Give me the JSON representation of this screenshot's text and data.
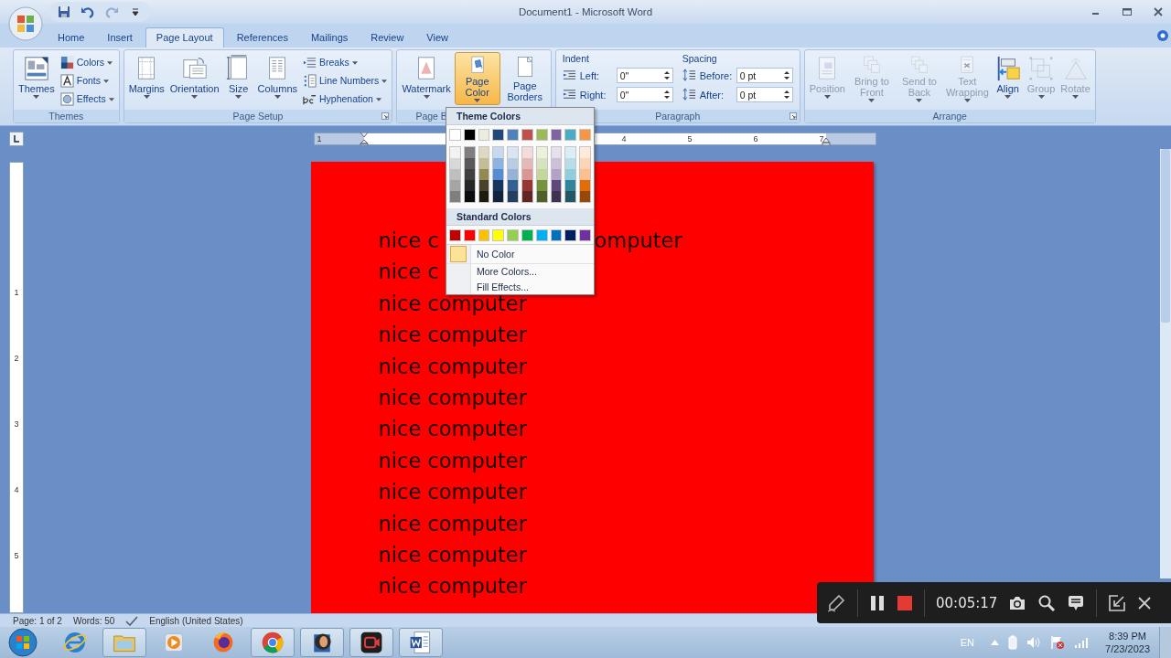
{
  "window": {
    "title": "Document1 - Microsoft Word"
  },
  "quick_access": [
    {
      "kind": "save",
      "disabled": false
    },
    {
      "kind": "undo",
      "disabled": false
    },
    {
      "kind": "redo",
      "disabled": true
    },
    {
      "kind": "customize",
      "disabled": false
    }
  ],
  "tabs": [
    {
      "label": "Home",
      "selected": false
    },
    {
      "label": "Insert",
      "selected": false
    },
    {
      "label": "Page Layout",
      "selected": true
    },
    {
      "label": "References",
      "selected": false
    },
    {
      "label": "Mailings",
      "selected": false
    },
    {
      "label": "Review",
      "selected": false
    },
    {
      "label": "View",
      "selected": false
    }
  ],
  "ribbon": {
    "groups": [
      {
        "label": "Themes",
        "launcher": false,
        "items": [
          {
            "kind": "large",
            "label": "Themes",
            "dropdown": true,
            "pressed": false,
            "disabled": false
          },
          {
            "kind": "small",
            "label": "Colors",
            "dropdown": true,
            "disabled": false
          },
          {
            "kind": "small",
            "label": "Fonts",
            "dropdown": true,
            "disabled": false
          },
          {
            "kind": "small",
            "label": "Effects",
            "dropdown": true,
            "disabled": false
          }
        ]
      },
      {
        "label": "Page Setup",
        "launcher": true,
        "items": [
          {
            "kind": "large",
            "label": "Margins",
            "dropdown": true,
            "pressed": false,
            "disabled": false
          },
          {
            "kind": "large",
            "label": "Orientation",
            "dropdown": true,
            "pressed": false,
            "disabled": false
          },
          {
            "kind": "large",
            "label": "Size",
            "dropdown": true,
            "pressed": false,
            "disabled": false
          },
          {
            "kind": "large",
            "label": "Columns",
            "dropdown": true,
            "pressed": false,
            "disabled": false
          },
          {
            "kind": "small",
            "label": "Breaks",
            "dropdown": true,
            "disabled": false
          },
          {
            "kind": "small",
            "label": "Line Numbers",
            "dropdown": true,
            "disabled": false
          },
          {
            "kind": "small",
            "label": "Hyphenation",
            "dropdown": true,
            "disabled": false
          }
        ]
      },
      {
        "label": "Page B",
        "launcher": false,
        "items": [
          {
            "kind": "large",
            "label": "Watermark",
            "dropdown": true,
            "pressed": false,
            "disabled": false
          },
          {
            "kind": "large",
            "label": "Page Color",
            "dropdown": true,
            "pressed": true,
            "disabled": false
          },
          {
            "kind": "large",
            "label": "Page Borders",
            "dropdown": false,
            "pressed": false,
            "disabled": false
          }
        ]
      },
      {
        "label": "Paragraph",
        "launcher": true,
        "items": [
          {
            "kind": "spinners",
            "heading": "Indent",
            "fields": [
              {
                "label": "Left:",
                "value": "0\""
              },
              {
                "label": "Right:",
                "value": "0\""
              }
            ]
          },
          {
            "kind": "spinners",
            "heading": "Spacing",
            "fields": [
              {
                "label": "Before:",
                "value": "0 pt"
              },
              {
                "label": "After:",
                "value": "0 pt"
              }
            ]
          }
        ]
      },
      {
        "label": "Arrange",
        "launcher": false,
        "items": [
          {
            "kind": "large",
            "label": "Position",
            "dropdown": true,
            "pressed": false,
            "disabled": true
          },
          {
            "kind": "large",
            "label": "Bring to Front",
            "dropdown": true,
            "pressed": false,
            "disabled": true
          },
          {
            "kind": "large",
            "label": "Send to Back",
            "dropdown": true,
            "pressed": false,
            "disabled": true
          },
          {
            "kind": "large",
            "label": "Text Wrapping",
            "dropdown": true,
            "pressed": false,
            "disabled": true
          },
          {
            "kind": "large",
            "label": "Align",
            "dropdown": true,
            "pressed": false,
            "disabled": false
          },
          {
            "kind": "large",
            "label": "Group",
            "dropdown": true,
            "pressed": false,
            "disabled": true
          },
          {
            "kind": "large",
            "label": "Rotate",
            "dropdown": true,
            "pressed": false,
            "disabled": true
          }
        ]
      }
    ]
  },
  "page_color_menu": {
    "theme_heading": "Theme Colors",
    "theme_colors": [
      {
        "color": "#ffffff",
        "shades": [
          {
            "color": "#f2f2f2"
          },
          {
            "color": "#d8d8d8"
          },
          {
            "color": "#bfbfbf"
          },
          {
            "color": "#a5a5a5"
          },
          {
            "color": "#7f7f7f"
          }
        ]
      },
      {
        "color": "#000000",
        "shades": [
          {
            "color": "#7f7f7f"
          },
          {
            "color": "#595959"
          },
          {
            "color": "#3f3f3f"
          },
          {
            "color": "#262626"
          },
          {
            "color": "#0c0c0c"
          }
        ]
      },
      {
        "color": "#eeece1",
        "shades": [
          {
            "color": "#ddd9c3"
          },
          {
            "color": "#c4bd97"
          },
          {
            "color": "#938953"
          },
          {
            "color": "#494429"
          },
          {
            "color": "#1d1b10"
          }
        ]
      },
      {
        "color": "#1f497d",
        "shades": [
          {
            "color": "#c6d9f0"
          },
          {
            "color": "#8db3e2"
          },
          {
            "color": "#548dd4"
          },
          {
            "color": "#17365d"
          },
          {
            "color": "#0f243e"
          }
        ]
      },
      {
        "color": "#4f81bd",
        "shades": [
          {
            "color": "#dbe5f1"
          },
          {
            "color": "#b8cce4"
          },
          {
            "color": "#95b3d7"
          },
          {
            "color": "#366092"
          },
          {
            "color": "#244061"
          }
        ]
      },
      {
        "color": "#c0504d",
        "shades": [
          {
            "color": "#f2dcdb"
          },
          {
            "color": "#e5b9b7"
          },
          {
            "color": "#d99694"
          },
          {
            "color": "#953734"
          },
          {
            "color": "#632423"
          }
        ]
      },
      {
        "color": "#9bbb59",
        "shades": [
          {
            "color": "#ebf1dd"
          },
          {
            "color": "#d7e3bc"
          },
          {
            "color": "#c3d69b"
          },
          {
            "color": "#76923c"
          },
          {
            "color": "#4f6128"
          }
        ]
      },
      {
        "color": "#8064a2",
        "shades": [
          {
            "color": "#e5e0ec"
          },
          {
            "color": "#ccc1d9"
          },
          {
            "color": "#b2a2c7"
          },
          {
            "color": "#5f497a"
          },
          {
            "color": "#3f3151"
          }
        ]
      },
      {
        "color": "#4bacc6",
        "shades": [
          {
            "color": "#dbeef3"
          },
          {
            "color": "#b7dde8"
          },
          {
            "color": "#92cddc"
          },
          {
            "color": "#31859b"
          },
          {
            "color": "#205867"
          }
        ]
      },
      {
        "color": "#f79646",
        "shades": [
          {
            "color": "#fdeada"
          },
          {
            "color": "#fbd5b5"
          },
          {
            "color": "#fac08f"
          },
          {
            "color": "#e36c09"
          },
          {
            "color": "#974806"
          }
        ]
      }
    ],
    "standard_heading": "Standard Colors",
    "standard_colors": [
      {
        "color": "#c00000"
      },
      {
        "color": "#ff0000"
      },
      {
        "color": "#ffc000"
      },
      {
        "color": "#ffff00"
      },
      {
        "color": "#92d050"
      },
      {
        "color": "#00b050"
      },
      {
        "color": "#00b0f0"
      },
      {
        "color": "#0070c0"
      },
      {
        "color": "#002060"
      },
      {
        "color": "#7030a0"
      }
    ],
    "items": [
      {
        "kind": "no-color",
        "label": "No Color"
      },
      {
        "kind": "plain",
        "label": "More Colors..."
      },
      {
        "kind": "plain",
        "label": "Fill Effects..."
      }
    ]
  },
  "ruler": {
    "left_numbers": [
      "1"
    ],
    "right_numbers": [
      "4",
      "5",
      "6",
      "7"
    ],
    "vertical_numbers": [
      "1",
      "2",
      "3",
      "4",
      "5"
    ]
  },
  "document": {
    "lines": [
      {
        "text": "nice c",
        "tail": "omputer"
      },
      {
        "text": "nice c"
      },
      {
        "text": "nice computer"
      },
      {
        "text": "nice computer"
      },
      {
        "text": "nice computer"
      },
      {
        "text": "nice computer"
      },
      {
        "text": "nice computer"
      },
      {
        "text": "nice computer"
      },
      {
        "text": "nice computer"
      },
      {
        "text": "nice computer"
      },
      {
        "text": "nice computer"
      },
      {
        "text": "nice computer"
      }
    ]
  },
  "status_bar": {
    "page": "Page: 1 of 2",
    "words": "Words: 50",
    "language": "English (United States)"
  },
  "taskbar": {
    "apps": [
      {
        "kind": "ie"
      },
      {
        "kind": "folder"
      },
      {
        "kind": "media"
      },
      {
        "kind": "firefox"
      },
      {
        "kind": "chrome"
      },
      {
        "kind": "viewer"
      },
      {
        "kind": "recorder"
      },
      {
        "kind": "word"
      }
    ],
    "language": "EN",
    "time": "8:39 PM",
    "date": "7/23/2023"
  },
  "recorder": {
    "time": "00:05:17"
  }
}
